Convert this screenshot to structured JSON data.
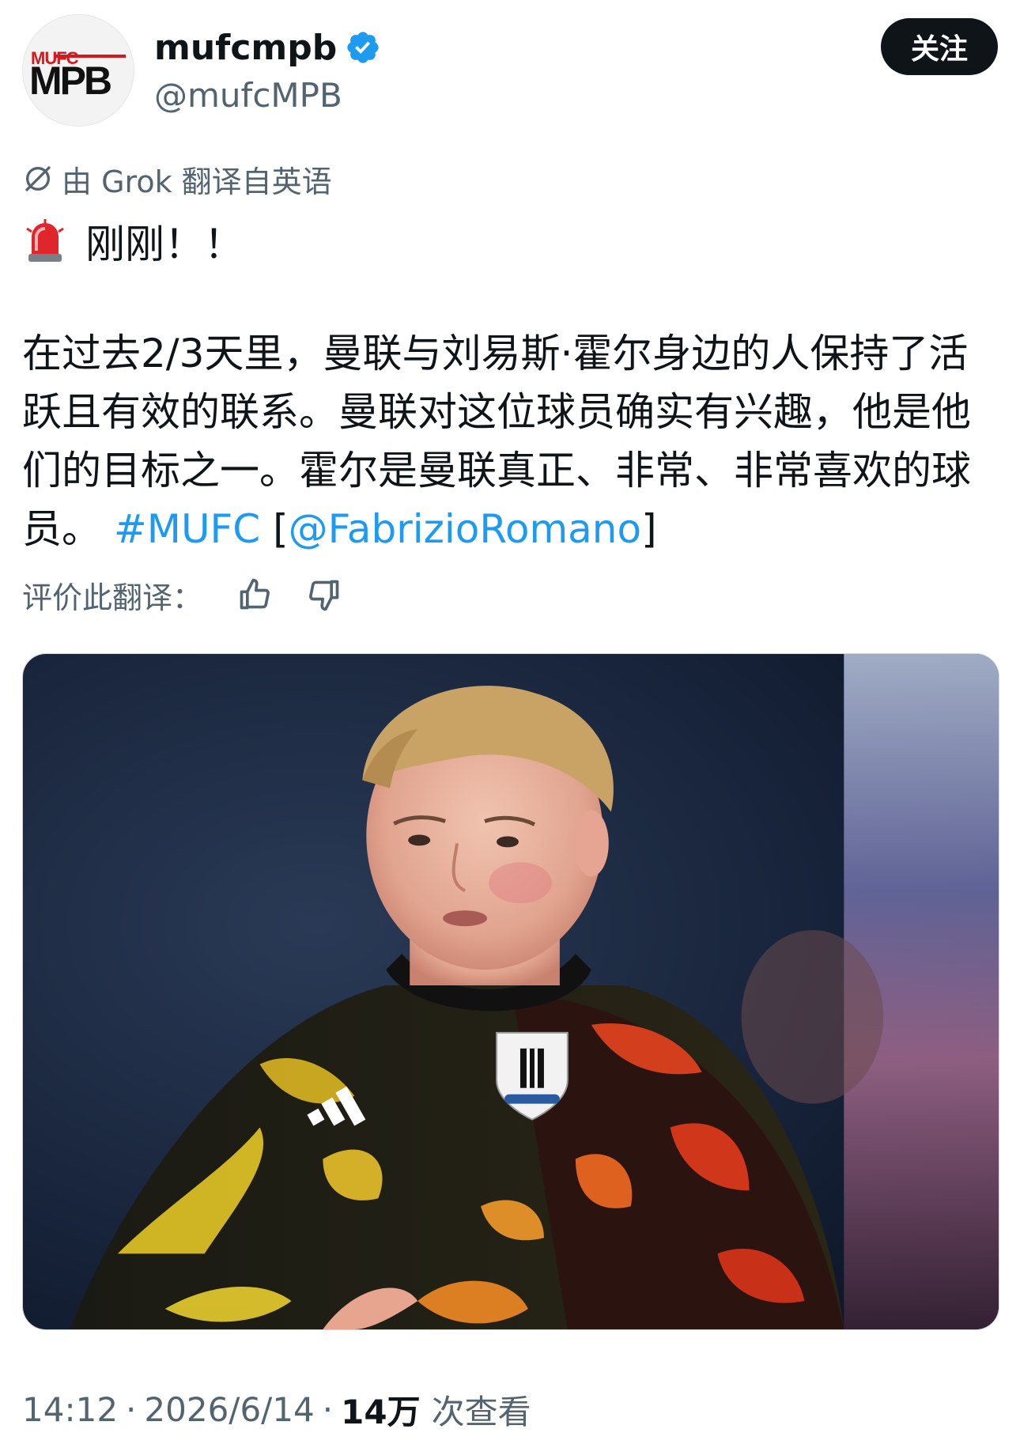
{
  "header": {
    "avatar_logo_top": "MUFC",
    "avatar_logo_main": "MPB",
    "display_name": "mufcmpb",
    "handle": "@mufcMPB",
    "follow_label": "关注"
  },
  "translation": {
    "label": "由 Grok 翻译自英语",
    "rate_label": "评价此翻译："
  },
  "post": {
    "alert_text": "刚刚！！",
    "body": "在过去2/3天里，曼联与刘易斯·霍尔身边的人保持了活跃且有效的联系。曼联对这位球员确实有兴趣，他是他们的目标之一。霍尔是曼联真正、非常、非常喜欢的球员。",
    "hashtag": "#MUFC",
    "bracket_open": "[",
    "mention": "@FabrizioRomano",
    "bracket_close": "]"
  },
  "meta": {
    "time": "14:12",
    "dot": "·",
    "date": "2026/6/14",
    "views_num": "14万",
    "views_label": "次查看"
  },
  "colors": {
    "link": "#1d9bf0",
    "muted": "#536471",
    "text": "#0f1419",
    "verified": "#1d9bf0"
  },
  "icons": [
    "verified-badge-icon",
    "grok-icon",
    "siren-emoji-icon",
    "thumbs-up-icon",
    "thumbs-down-icon"
  ]
}
